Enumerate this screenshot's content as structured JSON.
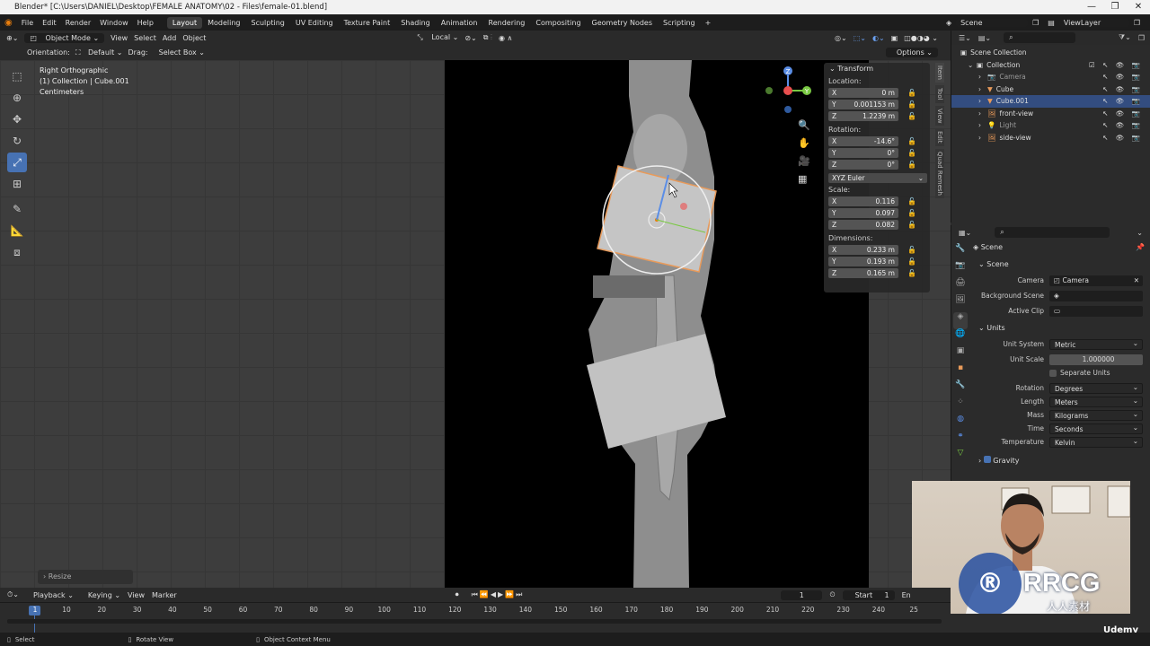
{
  "window": {
    "title": "Blender* [C:\\Users\\DANIEL\\Desktop\\FEMALE ANATOMY\\02 - Files\\female-01.blend]",
    "min": "—",
    "max": "❐",
    "close": "✕"
  },
  "menu": {
    "file": "File",
    "edit": "Edit",
    "render": "Render",
    "window": "Window",
    "help": "Help"
  },
  "workspaces": [
    "Layout",
    "Modeling",
    "Sculpting",
    "UV Editing",
    "Texture Paint",
    "Shading",
    "Animation",
    "Rendering",
    "Compositing",
    "Geometry Nodes",
    "Scripting"
  ],
  "workspace_add": "+",
  "scene": {
    "label": "Scene",
    "viewlayer": "ViewLayer"
  },
  "header": {
    "mode": "Object Mode",
    "view": "View",
    "select": "Select",
    "add": "Add",
    "object": "Object",
    "pivot": "Local"
  },
  "header2": {
    "orientation_label": "Orientation:",
    "orientation_value": "Default",
    "drag_label": "Drag:",
    "drag_value": "Select Box",
    "options": "Options"
  },
  "viewport_info": {
    "line1": "Right Orthographic",
    "line2": "(1) Collection | Cube.001",
    "line3": "Centimeters"
  },
  "transform": {
    "title": "Transform",
    "location": "Location:",
    "rotation": "Rotation:",
    "scale": "Scale:",
    "dimensions": "Dimensions:",
    "loc": [
      {
        "axis": "X",
        "value": "0 m"
      },
      {
        "axis": "Y",
        "value": "0.001153 m"
      },
      {
        "axis": "Z",
        "value": "1.2239 m"
      }
    ],
    "rot": [
      {
        "axis": "X",
        "value": "-14.6°"
      },
      {
        "axis": "Y",
        "value": "0°"
      },
      {
        "axis": "Z",
        "value": "0°"
      }
    ],
    "euler": "XYZ Euler",
    "scl": [
      {
        "axis": "X",
        "value": "0.116"
      },
      {
        "axis": "Y",
        "value": "0.097"
      },
      {
        "axis": "Z",
        "value": "0.082"
      }
    ],
    "dim": [
      {
        "axis": "X",
        "value": "0.233 m"
      },
      {
        "axis": "Y",
        "value": "0.193 m"
      },
      {
        "axis": "Z",
        "value": "0.165 m"
      }
    ]
  },
  "sidetabs": [
    "Item",
    "Tool",
    "View",
    "Edit",
    "Quad Remesh"
  ],
  "outliner": {
    "root": "Scene Collection",
    "items": [
      {
        "name": "Collection",
        "indent": 0
      },
      {
        "name": "Camera",
        "indent": 1
      },
      {
        "name": "Cube",
        "indent": 1
      },
      {
        "name": "Cube.001",
        "indent": 1
      },
      {
        "name": "front-view",
        "indent": 1
      },
      {
        "name": "Light",
        "indent": 1
      },
      {
        "name": "side-view",
        "indent": 1
      }
    ]
  },
  "properties": {
    "context": "Scene",
    "scene_section": "Scene",
    "camera_label": "Camera",
    "camera_value": "Camera",
    "bg_label": "Background Scene",
    "clip_label": "Active Clip",
    "units_section": "Units",
    "unit_system_label": "Unit System",
    "unit_system": "Metric",
    "unit_scale_label": "Unit Scale",
    "unit_scale": "1.000000",
    "separate_units": "Separate Units",
    "rotation_label": "Rotation",
    "rotation": "Degrees",
    "length_label": "Length",
    "length": "Meters",
    "mass_label": "Mass",
    "mass": "Kilograms",
    "time_label": "Time",
    "time": "Seconds",
    "temp_label": "Temperature",
    "temp": "Kelvin",
    "gravity": "Gravity"
  },
  "resize_panel": "Resize",
  "timeline": {
    "playback": "Playback",
    "keying": "Keying",
    "view": "View",
    "marker": "Marker",
    "current": "1",
    "start_label": "Start",
    "start": "1",
    "end_label": "En"
  },
  "ticks": [
    "1",
    "10",
    "20",
    "30",
    "40",
    "50",
    "60",
    "70",
    "80",
    "90",
    "100",
    "110",
    "120",
    "130",
    "140",
    "150",
    "160",
    "170",
    "180",
    "190",
    "200",
    "210",
    "220",
    "230",
    "240",
    "25"
  ],
  "status": {
    "select": "Select",
    "rotate": "Rotate View",
    "context": "Object Context Menu"
  },
  "watermark": {
    "logo": "RRCG",
    "sub": "人人素材",
    "udemy": "Udemy"
  }
}
